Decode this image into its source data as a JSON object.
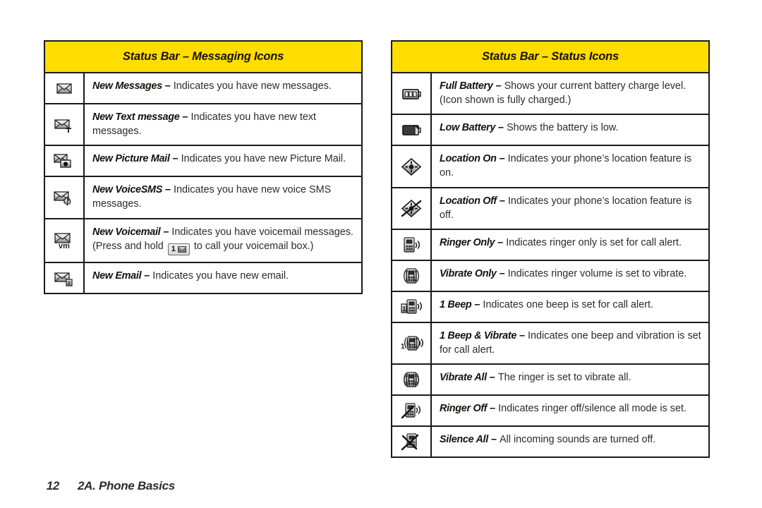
{
  "footer": {
    "page_number": "12",
    "section": "2A. Phone Basics"
  },
  "tables": [
    {
      "id": "messaging",
      "title": "Status Bar – Messaging Icons",
      "header_bg": "#FFDD00",
      "rows": [
        {
          "icon": "envelope-icon",
          "name": "New Messages",
          "dash": " – ",
          "desc": "Indicates you have new messages."
        },
        {
          "icon": "envelope-text-icon",
          "name": "New Text message",
          "dash": " – ",
          "desc": "Indicates you have new text messages."
        },
        {
          "icon": "envelope-picture-mail-icon",
          "name": "New Picture Mail",
          "dash": " – ",
          "desc": "Indicates you have new Picture Mail."
        },
        {
          "icon": "envelope-voice-sms-icon",
          "name": "New VoiceSMS",
          "dash": " – ",
          "desc": "Indicates you have new voice SMS messages."
        },
        {
          "icon": "envelope-voicemail-icon",
          "name": "New Voicemail",
          "dash": " – ",
          "desc_before_key": "Indicates you have voicemail messages. (Press and hold ",
          "key_label": "1",
          "key_glyph": "envelope",
          "desc_after_key": " to call your voicemail box.)"
        },
        {
          "icon": "envelope-email-icon",
          "name": "New Email",
          "dash": " – ",
          "desc": "Indicates you have new email."
        }
      ]
    },
    {
      "id": "status",
      "title": "Status Bar – Status Icons",
      "header_bg": "#FFDD00",
      "rows": [
        {
          "icon": "battery-full-icon",
          "name": "Full Battery",
          "dash": " – ",
          "desc": "Shows your current battery charge level. (Icon shown is fully charged.)"
        },
        {
          "icon": "battery-low-icon",
          "name": "Low Battery",
          "dash": " – ",
          "desc": "Shows the battery is low."
        },
        {
          "icon": "location-on-icon",
          "name": "Location On",
          "dash": " – ",
          "desc": "Indicates your phone’s location feature is on."
        },
        {
          "icon": "location-off-icon",
          "name": "Location Off",
          "dash": " – ",
          "desc": "Indicates your phone’s location feature is off."
        },
        {
          "icon": "ringer-only-icon",
          "name": "Ringer Only",
          "dash": " – ",
          "desc": "Indicates ringer only is set for call alert."
        },
        {
          "icon": "vibrate-only-icon",
          "name": "Vibrate Only",
          "dash": " – ",
          "desc": "Indicates ringer volume is set to vibrate."
        },
        {
          "icon": "one-beep-icon",
          "name": "1 Beep",
          "dash": " – ",
          "desc": "Indicates one beep is set for call alert."
        },
        {
          "icon": "one-beep-vibrate-icon",
          "name": "1 Beep & Vibrate",
          "dash": " – ",
          "desc": "Indicates one beep and vibration is set for call alert."
        },
        {
          "icon": "vibrate-all-icon",
          "name": "Vibrate All",
          "dash": " – ",
          "desc": "The ringer is set to vibrate all."
        },
        {
          "icon": "ringer-off-icon",
          "name": "Ringer Off",
          "dash": " – ",
          "desc": "Indicates ringer off/silence all mode is set."
        },
        {
          "icon": "silence-all-icon",
          "name": "Silence All",
          "dash": " – ",
          "desc": "All incoming sounds are turned off."
        }
      ]
    }
  ]
}
